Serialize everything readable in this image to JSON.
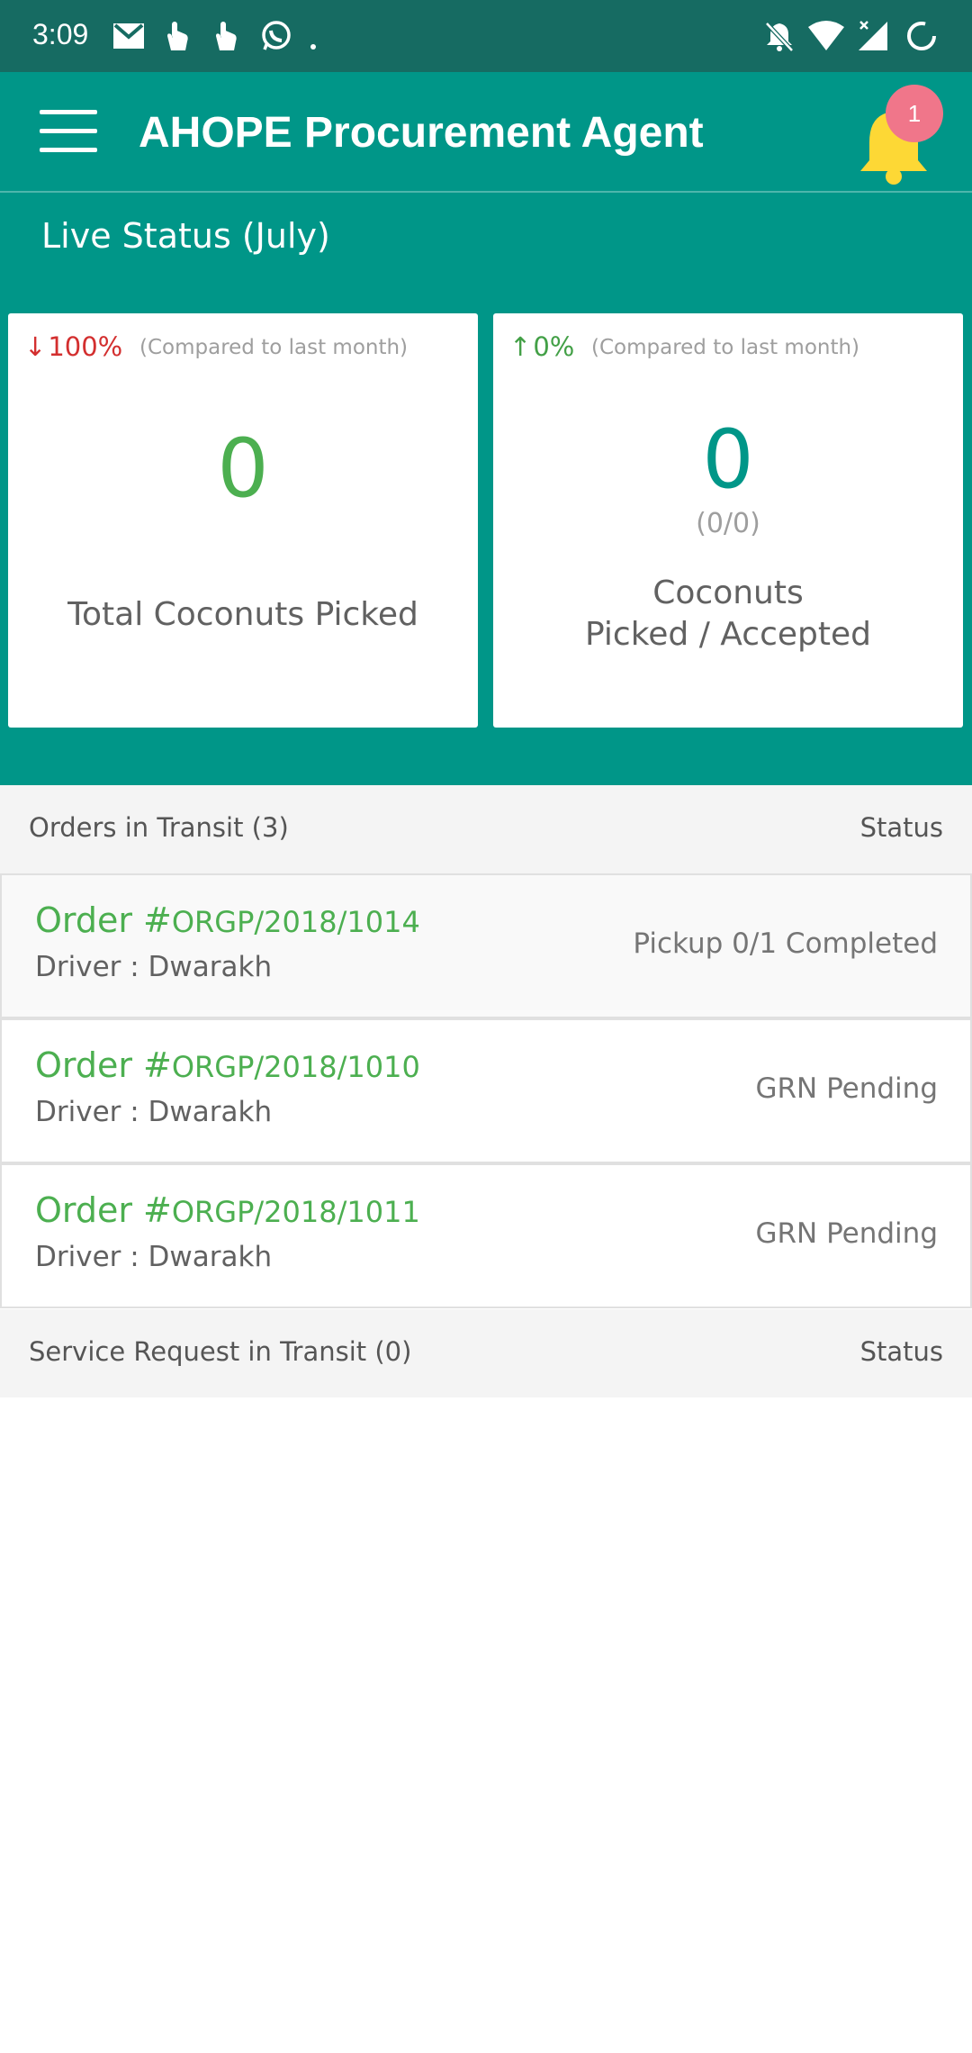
{
  "status_bar": {
    "time": "3:09",
    "left_icons": [
      "gmail-icon",
      "touch-icon",
      "touch-icon",
      "whatsapp-icon",
      "dot-icon"
    ],
    "right_icons": [
      "notifications-off-icon",
      "wifi-icon",
      "signal-icon",
      "battery-icon"
    ]
  },
  "app_bar": {
    "title": "AHOPE Procurement Agent",
    "notification_count": "1",
    "colors": {
      "background": "#009688",
      "status_bar": "#166b62",
      "badge": "#f0768a",
      "bell": "#fdd835"
    }
  },
  "live_status": {
    "title": "Live Status (July)",
    "cards": [
      {
        "trend": "100%",
        "trend_direction": "down",
        "trend_color": "#d32f2f",
        "compare_text": "(Compared to last month)",
        "value": "0",
        "label": "Total Coconuts Picked"
      },
      {
        "trend": "0%",
        "trend_direction": "up",
        "trend_color": "#43a047",
        "compare_text": "(Compared to last month)",
        "value": "0",
        "fraction": "(0/0)",
        "label_line1": "Coconuts",
        "label_line2": "Picked / Accepted"
      }
    ]
  },
  "orders_section": {
    "title": "Orders in Transit (3)",
    "status_header": "Status",
    "orders": [
      {
        "word": "Order",
        "hash": "#",
        "id": "ORGP/2018/1014",
        "driver": "Driver : Dwarakh",
        "status": "Pickup 0/1 Completed"
      },
      {
        "word": "Order",
        "hash": "#",
        "id": "ORGP/2018/1010",
        "driver": "Driver : Dwarakh",
        "status": "GRN Pending"
      },
      {
        "word": "Order",
        "hash": "#",
        "id": "ORGP/2018/1011",
        "driver": "Driver : Dwarakh",
        "status": "GRN Pending"
      }
    ]
  },
  "service_section": {
    "title": "Service Request in Transit (0)",
    "status_header": "Status"
  }
}
